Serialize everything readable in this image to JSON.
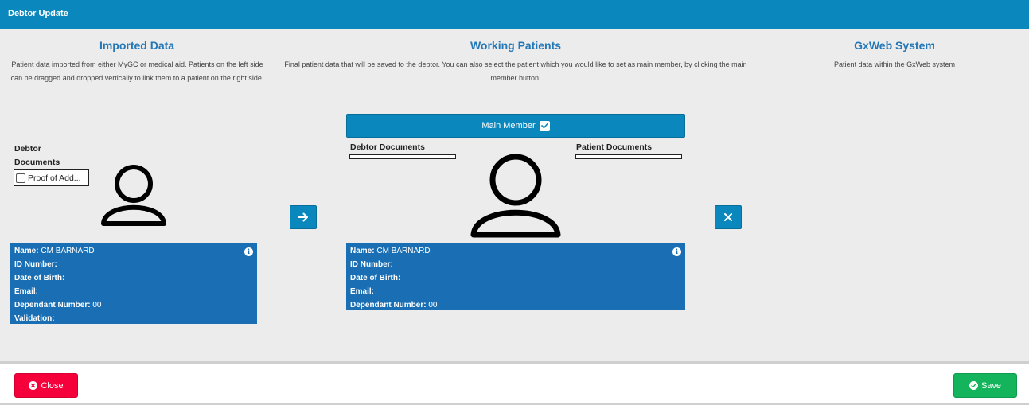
{
  "header": {
    "title": "Debtor Update"
  },
  "columns": {
    "imported": {
      "title": "Imported Data",
      "description": "Patient data imported from either MyGC or medical aid. Patients on the left side can be dragged and dropped vertically to link them to a patient on the right side."
    },
    "working": {
      "title": "Working Patients",
      "description": "Final patient data that will be saved to the debtor. You can also select the patient which you would like to set as main member, by clicking the main member button."
    },
    "gxweb": {
      "title": "GxWeb System",
      "description": "Patient data within the GxWeb system"
    }
  },
  "imported_panel": {
    "debtor_documents_label": "Debtor Documents",
    "document_item": "Proof of Add...",
    "document_checked": false,
    "card": {
      "rows": [
        {
          "label": "Name:",
          "value": "CM BARNARD"
        },
        {
          "label": "ID Number:",
          "value": ""
        },
        {
          "label": "Date of Birth:",
          "value": ""
        },
        {
          "label": "Email:",
          "value": ""
        },
        {
          "label": "Dependant Number:",
          "value": "00"
        },
        {
          "label": "Validation:",
          "value": ""
        }
      ]
    }
  },
  "working_panel": {
    "main_member_label": "Main Member",
    "main_member_checked": true,
    "debtor_documents_label": "Debtor Documents",
    "patient_documents_label": "Patient Documents",
    "card": {
      "rows": [
        {
          "label": "Name:",
          "value": "CM BARNARD"
        },
        {
          "label": "ID Number:",
          "value": ""
        },
        {
          "label": "Date of Birth:",
          "value": ""
        },
        {
          "label": "Email:",
          "value": ""
        },
        {
          "label": "Dependant Number:",
          "value": "00"
        }
      ]
    }
  },
  "icons": {
    "arrow": "arrow-right-icon",
    "remove": "close-icon",
    "info": "info-icon",
    "avatar": "user-icon"
  },
  "footer": {
    "close_label": "Close",
    "save_label": "Save"
  },
  "colors": {
    "header": "#0a87bd",
    "title_blue": "#2478b8",
    "card_blue": "#1a6fb4",
    "close_red": "#f5003a",
    "save_green": "#13b45c"
  }
}
